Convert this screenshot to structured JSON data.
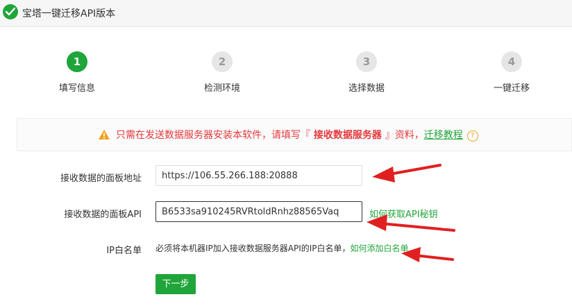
{
  "window": {
    "title": "宝塔一键迁移API版本"
  },
  "steps": [
    {
      "number": "1",
      "label": "填写信息",
      "active": true
    },
    {
      "number": "2",
      "label": "检测环境",
      "active": false
    },
    {
      "number": "3",
      "label": "选择数据",
      "active": false
    },
    {
      "number": "4",
      "label": "一键迁移",
      "active": false
    }
  ],
  "notice": {
    "text_before": "只需在发送数据服务器安装本软件，请填写『",
    "emphasis": " 接收数据服务器 ",
    "text_after": "』资料，",
    "link": "迁移教程",
    "help": "?"
  },
  "form": {
    "panel_address": {
      "label": "接收数据的面板地址",
      "value": "https://106.55.266.188:20888"
    },
    "panel_api": {
      "label": "接收数据的面板API",
      "value": "B6533sa910245RVRtoldRnhz88565Vaq",
      "help_link": "如何获取API秘钥"
    },
    "whitelist": {
      "label": "IP白名单",
      "text": "必须将本机器IP加入接收数据服务器API的IP白名单，",
      "link": "如何添加白名单"
    },
    "next_button": "下一步"
  },
  "colors": {
    "accent": "#20a53a",
    "warning": "#e4393c",
    "annotation": "#e02020"
  }
}
